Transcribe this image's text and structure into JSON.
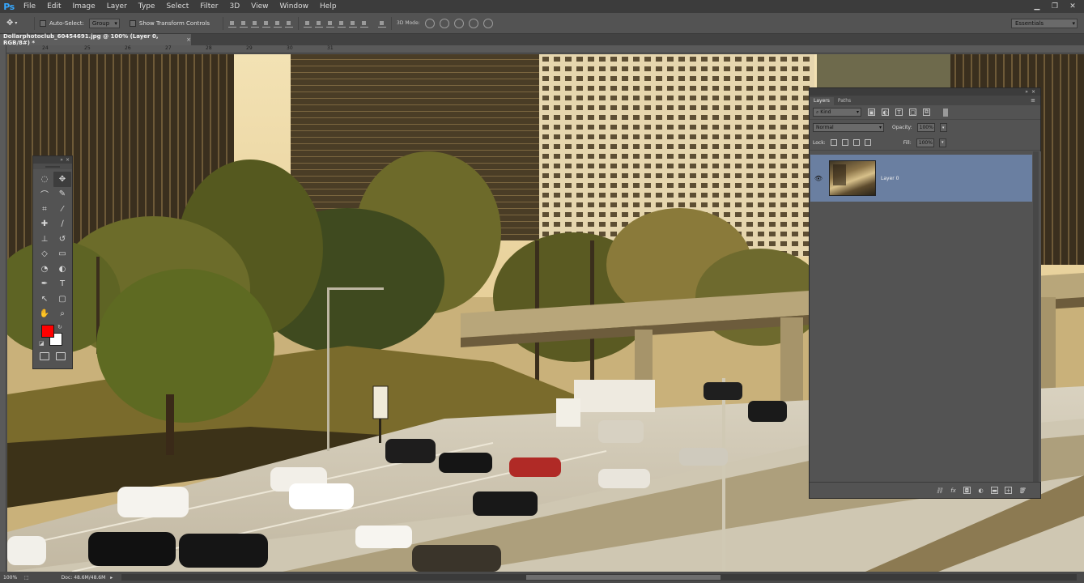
{
  "app": {
    "logo": "Ps",
    "menu": [
      "File",
      "Edit",
      "Image",
      "Layer",
      "Type",
      "Select",
      "Filter",
      "3D",
      "View",
      "Window",
      "Help"
    ],
    "window_controls": [
      "minimize-icon",
      "restore-icon",
      "close-icon"
    ]
  },
  "options_bar": {
    "auto_select_label": "Auto-Select:",
    "auto_select_value": "Group",
    "show_transform_label": "Show Transform Controls",
    "mode_label": "3D Mode:",
    "workspace": "Essentials"
  },
  "document": {
    "tab_title": "Dollarphotoclub_60454691.jpg @ 100% (Layer 0, RGB/8#) *",
    "ruler_ticks": [
      "24",
      "25",
      "26",
      "27",
      "28",
      "29",
      "30",
      "31"
    ]
  },
  "tools": {
    "items": [
      {
        "name": "marquee-tool-icon",
        "glyph": "◌"
      },
      {
        "name": "move-tool-icon",
        "glyph": "✥"
      },
      {
        "name": "lasso-tool-icon",
        "glyph": "⌒"
      },
      {
        "name": "quick-select-tool-icon",
        "glyph": "✎"
      },
      {
        "name": "crop-tool-icon",
        "glyph": "⌗"
      },
      {
        "name": "eyedropper-tool-icon",
        "glyph": "⁄"
      },
      {
        "name": "healing-brush-icon",
        "glyph": "✚"
      },
      {
        "name": "brush-tool-icon",
        "glyph": "∕"
      },
      {
        "name": "clone-stamp-icon",
        "glyph": "⊥"
      },
      {
        "name": "history-brush-icon",
        "glyph": "↺"
      },
      {
        "name": "eraser-tool-icon",
        "glyph": "◇"
      },
      {
        "name": "gradient-tool-icon",
        "glyph": "▭"
      },
      {
        "name": "blur-tool-icon",
        "glyph": "◔"
      },
      {
        "name": "dodge-tool-icon",
        "glyph": "◐"
      },
      {
        "name": "pen-tool-icon",
        "glyph": "✒"
      },
      {
        "name": "type-tool-icon",
        "glyph": "T"
      },
      {
        "name": "path-select-icon",
        "glyph": "↖"
      },
      {
        "name": "shape-tool-icon",
        "glyph": "▢"
      },
      {
        "name": "hand-tool-icon",
        "glyph": "✋"
      },
      {
        "name": "zoom-tool-icon",
        "glyph": "⌕"
      }
    ],
    "foreground_color": "#ff0000",
    "background_color": "#ffffff"
  },
  "layers_panel": {
    "tabs": [
      "Layers",
      "Paths"
    ],
    "filter_kind": "Kind",
    "blend_mode": "Normal",
    "opacity_label": "Opacity:",
    "opacity_value": "100%",
    "lock_label": "Lock:",
    "fill_label": "Fill:",
    "fill_value": "100%",
    "layers": [
      {
        "name": "Layer 0",
        "visible": true,
        "selected": true
      }
    ],
    "footer_icons": [
      "link-icon",
      "fx-icon",
      "mask-icon",
      "adjustment-icon",
      "group-icon",
      "new-layer-icon",
      "trash-icon"
    ]
  },
  "status": {
    "zoom": "100%",
    "doc_info": "Doc: 48.6M/48.6M"
  }
}
